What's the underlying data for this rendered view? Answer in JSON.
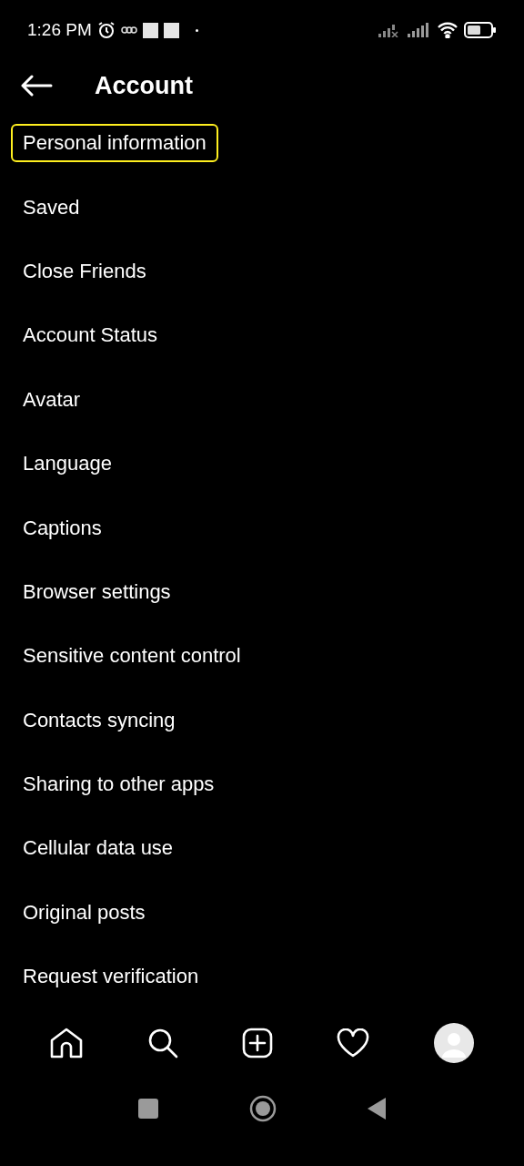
{
  "status_bar": {
    "time": "1:26 PM"
  },
  "header": {
    "title": "Account"
  },
  "menu_items": [
    {
      "label": "Personal information",
      "highlighted": true
    },
    {
      "label": "Saved",
      "highlighted": false
    },
    {
      "label": "Close Friends",
      "highlighted": false
    },
    {
      "label": "Account Status",
      "highlighted": false
    },
    {
      "label": "Avatar",
      "highlighted": false
    },
    {
      "label": "Language",
      "highlighted": false
    },
    {
      "label": "Captions",
      "highlighted": false
    },
    {
      "label": "Browser settings",
      "highlighted": false
    },
    {
      "label": "Sensitive content control",
      "highlighted": false
    },
    {
      "label": "Contacts syncing",
      "highlighted": false
    },
    {
      "label": "Sharing to other apps",
      "highlighted": false
    },
    {
      "label": "Cellular data use",
      "highlighted": false
    },
    {
      "label": "Original posts",
      "highlighted": false
    },
    {
      "label": "Request verification",
      "highlighted": false
    }
  ]
}
